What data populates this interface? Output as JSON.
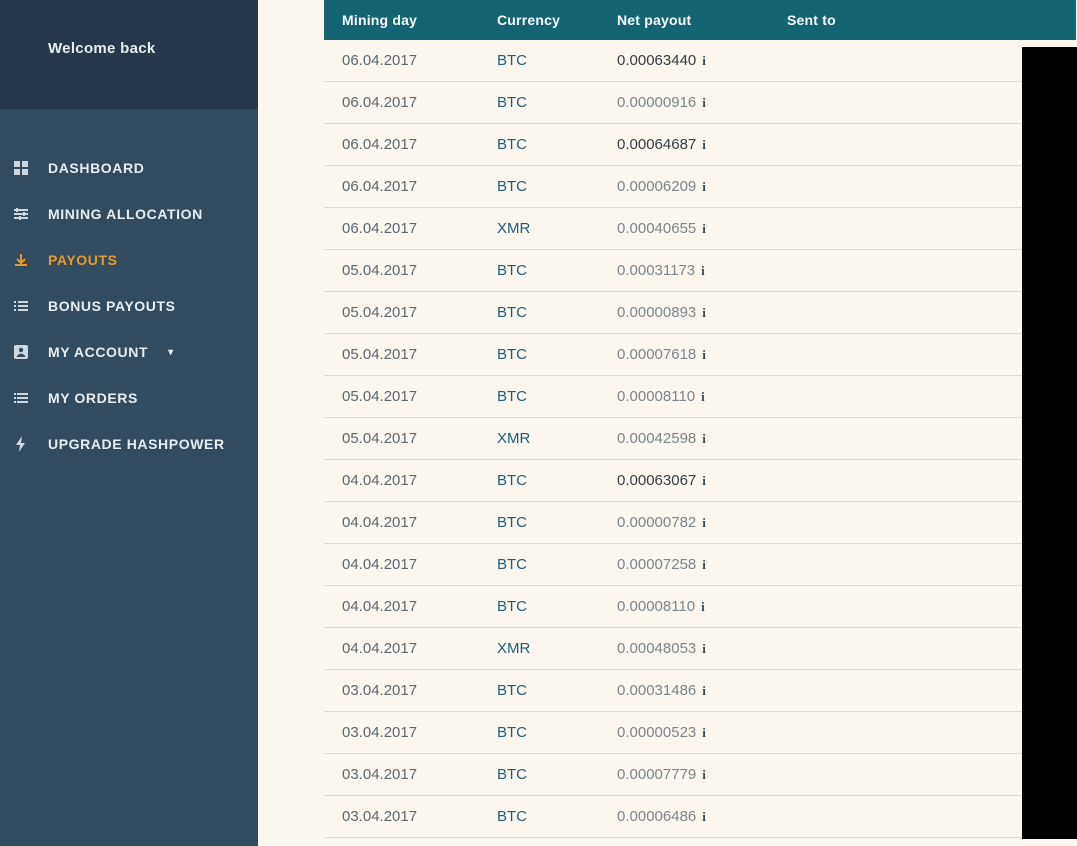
{
  "sidebar": {
    "welcome": "Welcome back",
    "items": [
      {
        "label": "DASHBOARD",
        "icon": "dashboard-icon",
        "active": false,
        "hasCaret": false
      },
      {
        "label": "MINING ALLOCATION",
        "icon": "sliders-icon",
        "active": false,
        "hasCaret": false
      },
      {
        "label": "PAYOUTS",
        "icon": "download-icon",
        "active": true,
        "hasCaret": false
      },
      {
        "label": "BONUS PAYOUTS",
        "icon": "list-icon",
        "active": false,
        "hasCaret": false
      },
      {
        "label": "MY ACCOUNT",
        "icon": "user-icon",
        "active": false,
        "hasCaret": true
      },
      {
        "label": "MY ORDERS",
        "icon": "lines-icon",
        "active": false,
        "hasCaret": false
      },
      {
        "label": "UPGRADE HASHPOWER",
        "icon": "bolt-icon",
        "active": false,
        "hasCaret": false
      }
    ]
  },
  "table": {
    "headers": {
      "mining_day": "Mining day",
      "currency": "Currency",
      "net_payout": "Net payout",
      "sent_to": "Sent to"
    },
    "rows": [
      {
        "day": "06.04.2017",
        "currency": "BTC",
        "payout": "0.00063440",
        "strong": true
      },
      {
        "day": "06.04.2017",
        "currency": "BTC",
        "payout": "0.00000916",
        "strong": false
      },
      {
        "day": "06.04.2017",
        "currency": "BTC",
        "payout": "0.00064687",
        "strong": true
      },
      {
        "day": "06.04.2017",
        "currency": "BTC",
        "payout": "0.00006209",
        "strong": false
      },
      {
        "day": "06.04.2017",
        "currency": "XMR",
        "payout": "0.00040655",
        "strong": false
      },
      {
        "day": "05.04.2017",
        "currency": "BTC",
        "payout": "0.00031173",
        "strong": false
      },
      {
        "day": "05.04.2017",
        "currency": "BTC",
        "payout": "0.00000893",
        "strong": false
      },
      {
        "day": "05.04.2017",
        "currency": "BTC",
        "payout": "0.00007618",
        "strong": false
      },
      {
        "day": "05.04.2017",
        "currency": "BTC",
        "payout": "0.00008110",
        "strong": false
      },
      {
        "day": "05.04.2017",
        "currency": "XMR",
        "payout": "0.00042598",
        "strong": false
      },
      {
        "day": "04.04.2017",
        "currency": "BTC",
        "payout": "0.00063067",
        "strong": true
      },
      {
        "day": "04.04.2017",
        "currency": "BTC",
        "payout": "0.00000782",
        "strong": false
      },
      {
        "day": "04.04.2017",
        "currency": "BTC",
        "payout": "0.00007258",
        "strong": false
      },
      {
        "day": "04.04.2017",
        "currency": "BTC",
        "payout": "0.00008110",
        "strong": false
      },
      {
        "day": "04.04.2017",
        "currency": "XMR",
        "payout": "0.00048053",
        "strong": false
      },
      {
        "day": "03.04.2017",
        "currency": "BTC",
        "payout": "0.00031486",
        "strong": false
      },
      {
        "day": "03.04.2017",
        "currency": "BTC",
        "payout": "0.00000523",
        "strong": false
      },
      {
        "day": "03.04.2017",
        "currency": "BTC",
        "payout": "0.00007779",
        "strong": false
      },
      {
        "day": "03.04.2017",
        "currency": "BTC",
        "payout": "0.00006486",
        "strong": false
      }
    ]
  },
  "icons": {
    "info_glyph": "i"
  }
}
